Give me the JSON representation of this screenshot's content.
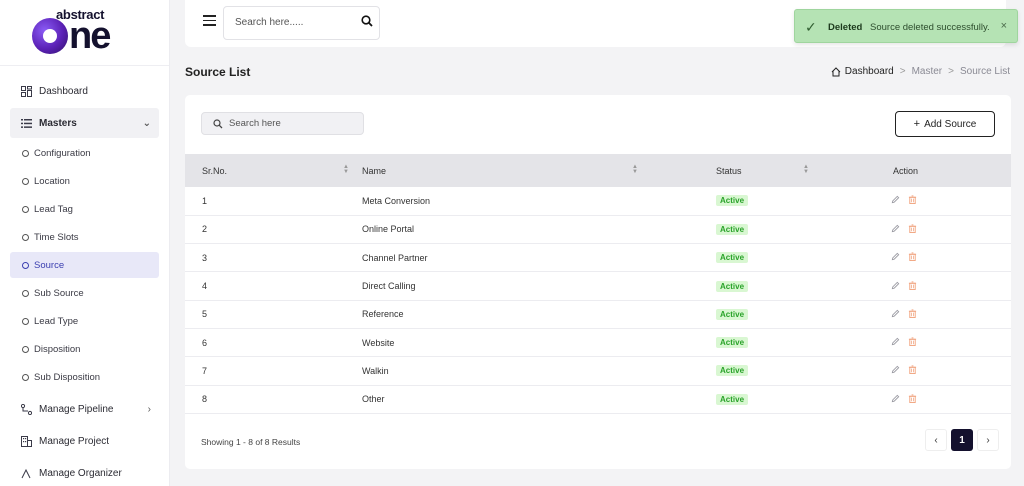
{
  "brand": {
    "top": "abstract",
    "bottom_o": "o",
    "bottom_rest": "ne"
  },
  "sidebar": {
    "top_items": [
      {
        "label": "Dashboard",
        "icon": "grid-icon"
      }
    ],
    "masters": {
      "label": "Masters",
      "icon": "list-icon",
      "expanded": true
    },
    "sub_items": [
      {
        "label": "Configuration"
      },
      {
        "label": "Location"
      },
      {
        "label": "Lead Tag"
      },
      {
        "label": "Time Slots"
      },
      {
        "label": "Source",
        "active": true
      },
      {
        "label": "Sub Source"
      },
      {
        "label": "Lead Type"
      },
      {
        "label": "Disposition"
      },
      {
        "label": "Sub Disposition"
      }
    ],
    "bottom_items": [
      {
        "label": "Manage Pipeline",
        "icon": "pipeline-icon"
      },
      {
        "label": "Manage Project",
        "icon": "building-icon"
      },
      {
        "label": "Manage Organizer",
        "icon": "organizer-icon"
      }
    ]
  },
  "topbar": {
    "search_placeholder": "Search here....."
  },
  "toast": {
    "title": "Deleted",
    "message": "Source deleted successfully.",
    "close": "×",
    "color": "#b5e3b4"
  },
  "page": {
    "title": "Source List"
  },
  "breadcrumb": {
    "home": "Dashboard",
    "sep": ">",
    "middle": "Master",
    "current": "Source List"
  },
  "toolbar": {
    "search_placeholder": "Search here",
    "add_label": "Add Source",
    "add_plus": "+"
  },
  "table": {
    "columns": [
      "Sr.No.",
      "Name",
      "Status",
      "Action"
    ],
    "rows": [
      {
        "sr": "1",
        "name": "Meta Conversion",
        "status": "Active"
      },
      {
        "sr": "2",
        "name": "Online Portal",
        "status": "Active"
      },
      {
        "sr": "3",
        "name": "Channel Partner",
        "status": "Active"
      },
      {
        "sr": "4",
        "name": "Direct Calling",
        "status": "Active"
      },
      {
        "sr": "5",
        "name": "Reference",
        "status": "Active"
      },
      {
        "sr": "6",
        "name": "Website",
        "status": "Active"
      },
      {
        "sr": "7",
        "name": "Walkin",
        "status": "Active"
      },
      {
        "sr": "8",
        "name": "Other",
        "status": "Active"
      }
    ]
  },
  "pagination": {
    "summary": "Showing 1 - 8 of 8 Results",
    "current_page": "1",
    "prev": "‹",
    "next": "›"
  },
  "colors": {
    "accent": "#14112e",
    "active_nav": "#3b3fb0",
    "status_active": "#2aa32a",
    "delete_icon": "#f0a07a"
  }
}
